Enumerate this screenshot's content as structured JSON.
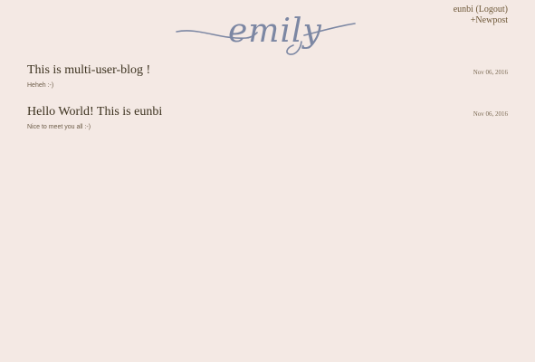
{
  "header": {
    "logo_text": "emily",
    "user_name": "eunbi",
    "logout_label": "(Logout)",
    "newpost_label": "+Newpost"
  },
  "posts": [
    {
      "title": "This is multi-user-blog !",
      "date": "Nov 06, 2016",
      "excerpt": "Heheh :-)"
    },
    {
      "title": "Hello World! This is eunbi",
      "date": "Nov 06, 2016",
      "excerpt": "Nice to meet you all :-)"
    }
  ],
  "colors": {
    "background": "#f4e9e4",
    "logo": "#7c87a3",
    "title": "#3c321f",
    "meta": "#7c6b54"
  }
}
